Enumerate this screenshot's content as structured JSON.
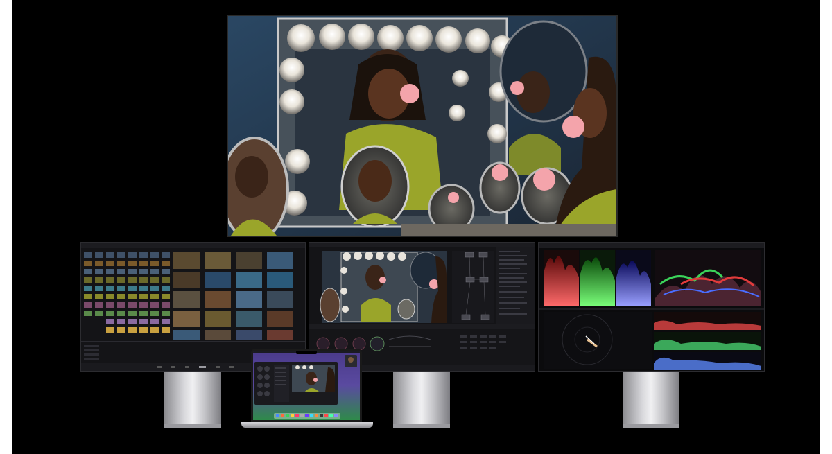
{
  "scene": {
    "subject": "",
    "colors": {
      "background": "#000000",
      "hero_warm": "#c48a3a",
      "hero_cool": "#2c4a66",
      "scope_red": "#e23b3b",
      "scope_green": "#3bd35a",
      "scope_blue": "#4a6dff",
      "laptop_wallpaper": "#2f7a4a"
    }
  },
  "displays": {
    "hero": {
      "label": ""
    },
    "left_monitor": {
      "label": ""
    },
    "center_monitor": {
      "label": ""
    },
    "right_monitor": {
      "label": ""
    },
    "laptop": {
      "label": ""
    }
  }
}
